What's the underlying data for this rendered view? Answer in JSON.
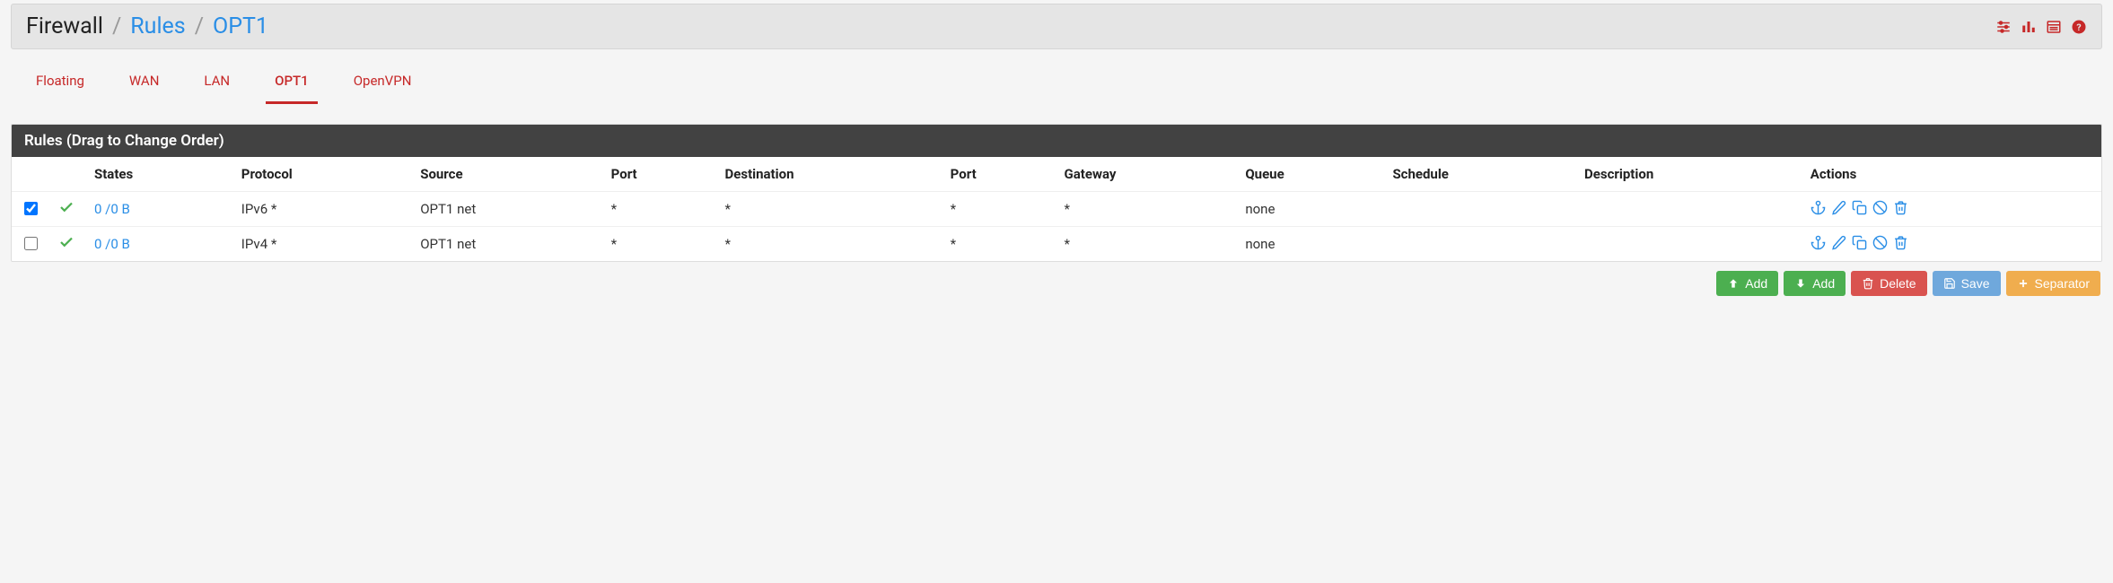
{
  "breadcrumb": {
    "root": "Firewall",
    "mid": "Rules",
    "leaf": "OPT1"
  },
  "tabs": [
    {
      "label": "Floating",
      "active": false
    },
    {
      "label": "WAN",
      "active": false
    },
    {
      "label": "LAN",
      "active": false
    },
    {
      "label": "OPT1",
      "active": true
    },
    {
      "label": "OpenVPN",
      "active": false
    }
  ],
  "panel_title": "Rules (Drag to Change Order)",
  "columns": [
    "",
    "",
    "States",
    "Protocol",
    "Source",
    "Port",
    "Destination",
    "Port",
    "Gateway",
    "Queue",
    "Schedule",
    "Description",
    "Actions"
  ],
  "rows": [
    {
      "checked": true,
      "states": "0 /0 B",
      "protocol": "IPv6 *",
      "source": "OPT1 net",
      "sport": "*",
      "destination": "*",
      "dport": "*",
      "gateway": "*",
      "queue": "none",
      "schedule": "",
      "description": ""
    },
    {
      "checked": false,
      "states": "0 /0 B",
      "protocol": "IPv4 *",
      "source": "OPT1 net",
      "sport": "*",
      "destination": "*",
      "dport": "*",
      "gateway": "*",
      "queue": "none",
      "schedule": "",
      "description": ""
    }
  ],
  "buttons": {
    "add_top": "Add",
    "add_bottom": "Add",
    "delete": "Delete",
    "save": "Save",
    "separator": "Separator"
  }
}
